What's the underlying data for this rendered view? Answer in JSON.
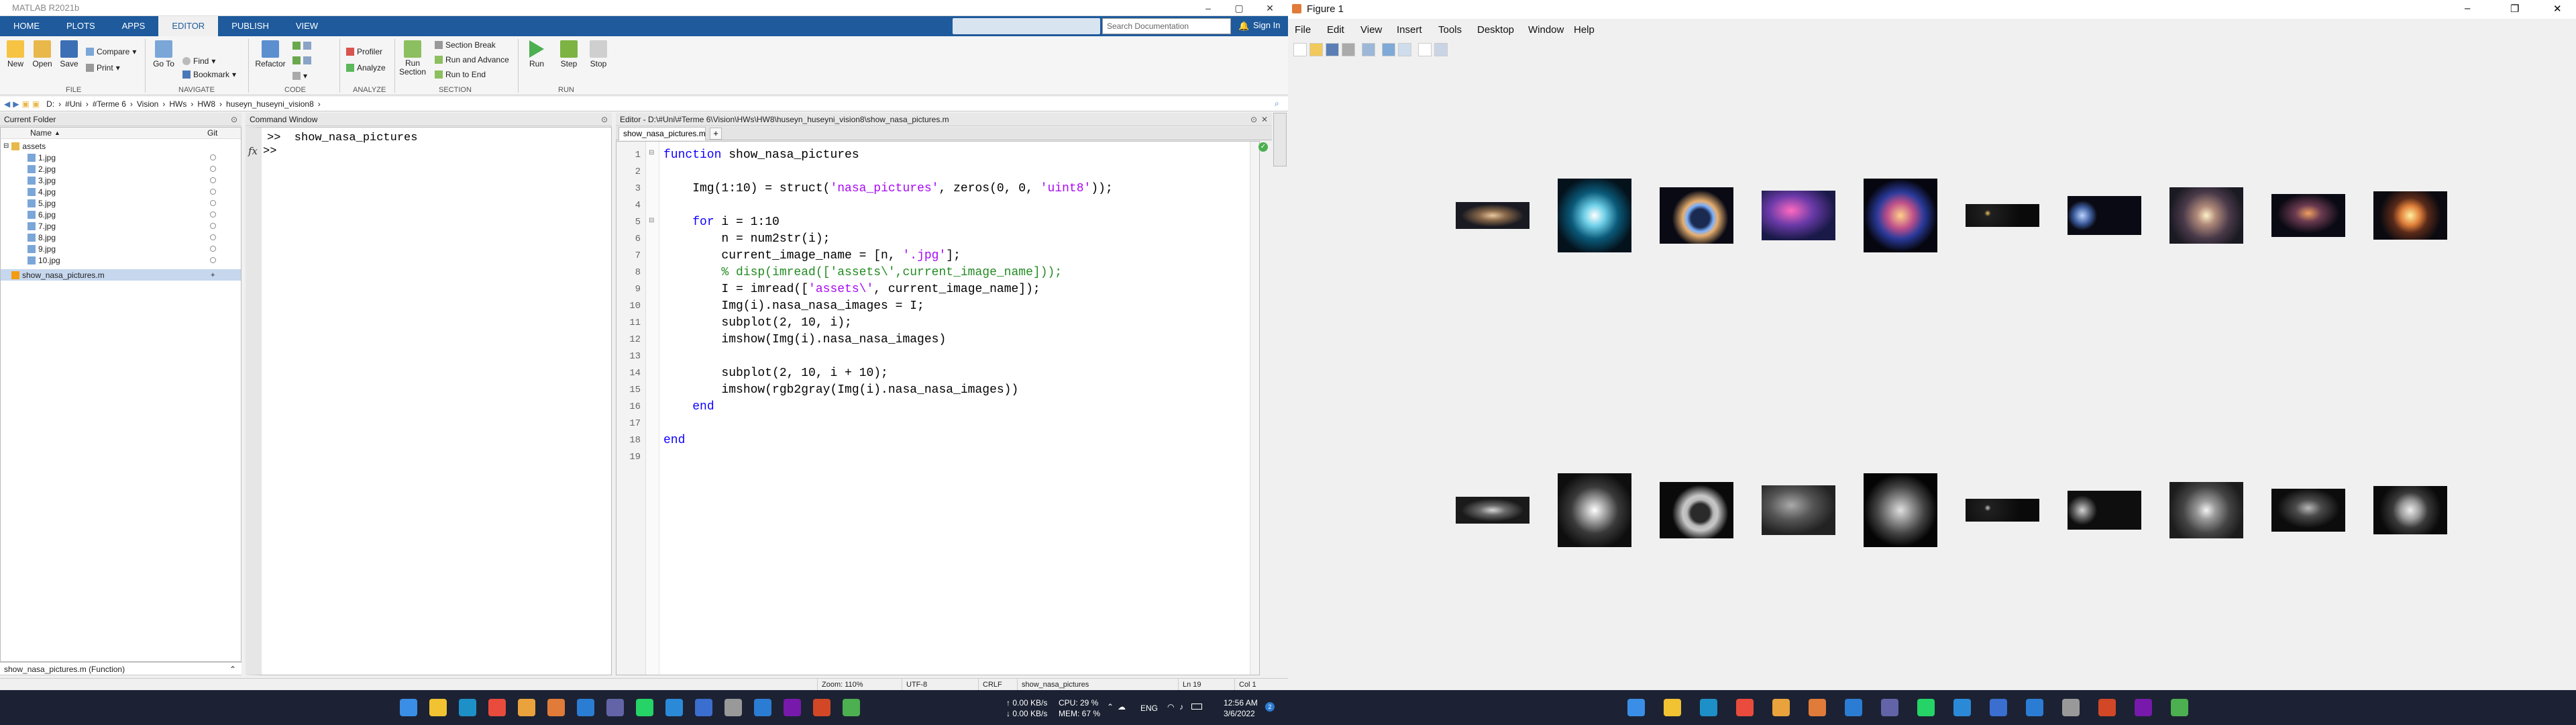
{
  "matlab": {
    "title": "MATLAB R2021b",
    "ribbon_tabs": [
      "HOME",
      "PLOTS",
      "APPS",
      "EDITOR",
      "PUBLISH",
      "VIEW"
    ],
    "search_placeholder": "Search Documentation",
    "sign_in": "Sign In",
    "file_group": {
      "new": "New",
      "open": "Open",
      "save": "Save",
      "compare": "Compare",
      "print": "Print",
      "label": "FILE"
    },
    "navigate_group": {
      "goto": "Go To",
      "find": "Find",
      "bookmark": "Bookmark",
      "label": "NAVIGATE"
    },
    "code_group": {
      "refactor": "Refactor",
      "label": "CODE"
    },
    "analyze_group": {
      "profiler": "Profiler",
      "analyze": "Analyze",
      "label": "ANALYZE"
    },
    "section_group": {
      "run_section": "Run Section",
      "section_break": "Section Break",
      "run_advance": "Run and Advance",
      "run_end": "Run to End",
      "label": "SECTION"
    },
    "run_group": {
      "run": "Run",
      "step": "Step",
      "stop": "Stop",
      "label": "RUN"
    },
    "path": [
      "D:",
      "#Uni",
      "#Terme 6",
      "Vision",
      "HWs",
      "HW8",
      "huseyn_huseyni_vision8"
    ],
    "current_folder": {
      "title": "Current Folder",
      "col_name": "Name",
      "sort_arrow": "▲",
      "col_git": "Git",
      "folder": "assets",
      "files": [
        "1.jpg",
        "2.jpg",
        "3.jpg",
        "4.jpg",
        "5.jpg",
        "6.jpg",
        "7.jpg",
        "8.jpg",
        "9.jpg",
        "10.jpg"
      ],
      "script": "show_nasa_pictures.m",
      "details": "show_nasa_pictures.m  (Function)"
    },
    "command_window": {
      "title": "Command Window",
      "line1": ">>  show_nasa_pictures",
      "prompt": ">>",
      "fx": "fx"
    },
    "editor": {
      "title": "Editor - D:\\#Uni\\#Terme 6\\Vision\\HWs\\HW8\\huseyn_huseyni_vision8\\show_nasa_pictures.m",
      "tab": "show_nasa_pictures.m",
      "add_tab": "+",
      "lines": [
        {
          "n": "1",
          "segs": [
            {
              "t": "function",
              "c": "kw"
            },
            {
              "t": " show_nasa_pictures",
              "c": ""
            }
          ]
        },
        {
          "n": "2",
          "segs": []
        },
        {
          "n": "3",
          "segs": [
            {
              "t": "    Img(1:10) = struct(",
              "c": ""
            },
            {
              "t": "'nasa_pictures'",
              "c": "st"
            },
            {
              "t": ", zeros(0, 0, ",
              "c": ""
            },
            {
              "t": "'uint8'",
              "c": "st"
            },
            {
              "t": "));",
              "c": ""
            }
          ]
        },
        {
          "n": "4",
          "segs": []
        },
        {
          "n": "5",
          "segs": [
            {
              "t": "    ",
              "c": ""
            },
            {
              "t": "for",
              "c": "kw"
            },
            {
              "t": " i = 1:10",
              "c": ""
            }
          ]
        },
        {
          "n": "6",
          "segs": [
            {
              "t": "        n = num2str(i);",
              "c": ""
            }
          ]
        },
        {
          "n": "7",
          "segs": [
            {
              "t": "        current_image_name = [n, ",
              "c": ""
            },
            {
              "t": "'.jpg'",
              "c": "st"
            },
            {
              "t": "];",
              "c": ""
            }
          ]
        },
        {
          "n": "8",
          "segs": [
            {
              "t": "        % disp(imread(['assets\\',current_image_name]));",
              "c": "cm"
            }
          ]
        },
        {
          "n": "9",
          "segs": [
            {
              "t": "        I = imread([",
              "c": ""
            },
            {
              "t": "'assets\\'",
              "c": "st"
            },
            {
              "t": ", current_image_name]);",
              "c": ""
            }
          ]
        },
        {
          "n": "10",
          "segs": [
            {
              "t": "        Img(i).nasa_nasa_images = I;",
              "c": ""
            }
          ]
        },
        {
          "n": "11",
          "segs": [
            {
              "t": "        subplot(2, 10, i);",
              "c": ""
            }
          ]
        },
        {
          "n": "12",
          "segs": [
            {
              "t": "        imshow(Img(i).nasa_nasa_images)",
              "c": ""
            }
          ]
        },
        {
          "n": "13",
          "segs": []
        },
        {
          "n": "14",
          "segs": [
            {
              "t": "        subplot(2, 10, i + 10);",
              "c": ""
            }
          ]
        },
        {
          "n": "15",
          "segs": [
            {
              "t": "        imshow(rgb2gray(Img(i).nasa_nasa_images))",
              "c": ""
            }
          ]
        },
        {
          "n": "16",
          "segs": [
            {
              "t": "    ",
              "c": ""
            },
            {
              "t": "end",
              "c": "kw"
            }
          ]
        },
        {
          "n": "17",
          "segs": []
        },
        {
          "n": "18",
          "segs": [
            {
              "t": "end",
              "c": "kw"
            }
          ]
        },
        {
          "n": "19",
          "segs": []
        }
      ]
    },
    "status": {
      "zoom": "Zoom: 110%",
      "encoding": "UTF-8",
      "eol": "CRLF",
      "function": "show_nasa_pictures",
      "ln": "Ln  19",
      "col": "Col  1"
    },
    "tray": {
      "net_up": "↑ 0.00 KB/s",
      "net_down": "↓ 0.00 KB/s",
      "cpu": "CPU: 29 %",
      "mem": "MEM: 67 %",
      "lang": "ENG",
      "time": "12:56 AM",
      "date": "3/6/2022"
    }
  },
  "figure": {
    "title": "Figure 1",
    "menus": [
      "File",
      "Edit",
      "View",
      "Insert",
      "Tools",
      "Desktop",
      "Window",
      "Help"
    ],
    "colors": {
      "accent": "#1e5a9c",
      "keyword": "#0e00ff",
      "string": "#a709f5",
      "comment": "#228b22"
    }
  }
}
